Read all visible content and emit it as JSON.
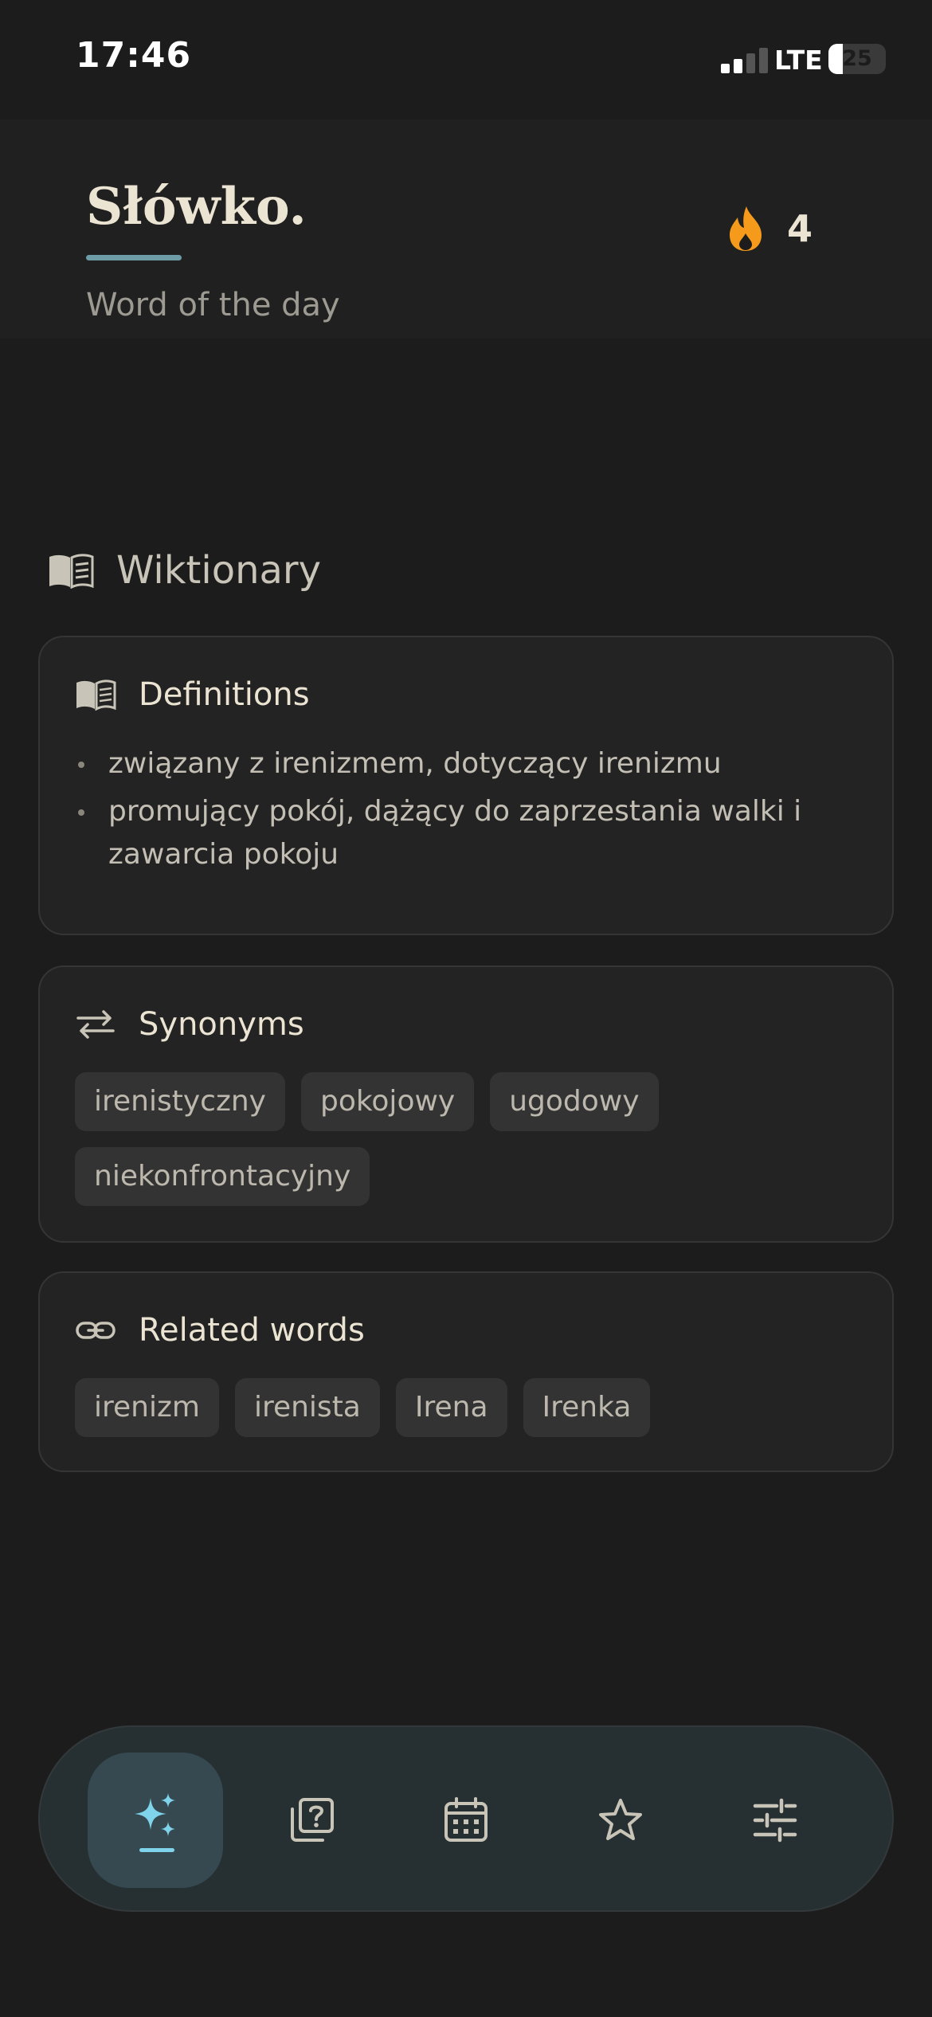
{
  "status_bar": {
    "time": "17:46",
    "network": "LTE",
    "battery": "25",
    "battery_level": 0.25,
    "signal_bars_active": 2,
    "signal_bars_total": 4
  },
  "header": {
    "title": "Słówko.",
    "subtitle": "Word of the day",
    "streak_count": "4",
    "streak_icon": "flame-icon",
    "accent_color": "#6e9ca6",
    "streak_color": "#f59a1b"
  },
  "section": {
    "title": "Wiktionary",
    "icon": "book-icon"
  },
  "definitions": {
    "title": "Definitions",
    "icon": "book-icon",
    "items": [
      "związany z irenizmem, dotyczący irenizmu",
      "promujący pokój, dążący do zaprzestania walki i zawarcia pokoju"
    ]
  },
  "synonyms": {
    "title": "Synonyms",
    "icon": "swap-arrows-icon",
    "items": [
      "irenistyczny",
      "pokojowy",
      "ugodowy",
      "niekonfrontacyjny"
    ]
  },
  "related": {
    "title": "Related words",
    "icon": "link-icon",
    "items": [
      "irenizm",
      "irenista",
      "Irena",
      "Irenka"
    ]
  },
  "nav": {
    "active_index": 0,
    "active_color": "#7fd3ea",
    "items": [
      {
        "icon": "sparkles-icon"
      },
      {
        "icon": "quiz-cards-icon"
      },
      {
        "icon": "calendar-icon"
      },
      {
        "icon": "star-icon"
      },
      {
        "icon": "sliders-icon"
      }
    ]
  }
}
